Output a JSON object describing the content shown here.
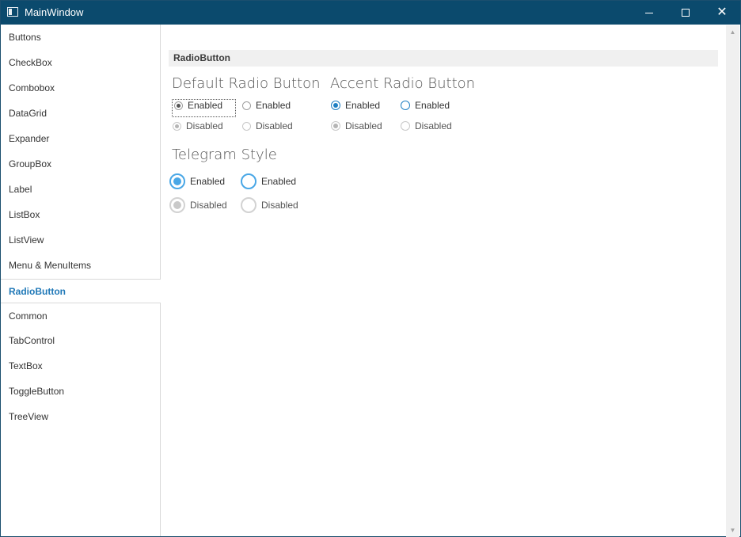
{
  "window": {
    "title": "MainWindow"
  },
  "sidebar": {
    "items": [
      {
        "label": "Buttons"
      },
      {
        "label": "CheckBox"
      },
      {
        "label": "Combobox"
      },
      {
        "label": "DataGrid"
      },
      {
        "label": "Expander"
      },
      {
        "label": "GroupBox"
      },
      {
        "label": "Label"
      },
      {
        "label": "ListBox"
      },
      {
        "label": "ListView"
      },
      {
        "label": "Menu & MenuItems"
      },
      {
        "label": "RadioButton",
        "selected": true
      },
      {
        "label": "Common"
      },
      {
        "label": "TabControl"
      },
      {
        "label": "TextBox"
      },
      {
        "label": "ToggleButton"
      },
      {
        "label": "TreeView"
      }
    ]
  },
  "content": {
    "header": "RadioButton",
    "default_group": {
      "title": "Default Radio Button",
      "enabled_checked": "Enabled",
      "enabled_unchecked": "Enabled",
      "disabled_checked": "Disabled",
      "disabled_unchecked": "Disabled"
    },
    "accent_group": {
      "title": "Accent Radio Button",
      "enabled_checked": "Enabled",
      "enabled_unchecked": "Enabled",
      "disabled_checked": "Disabled",
      "disabled_unchecked": "Disabled"
    },
    "telegram_group": {
      "title": "Telegram Style",
      "enabled_checked": "Enabled",
      "enabled_unchecked": "Enabled",
      "disabled_checked": "Disabled",
      "disabled_unchecked": "Disabled"
    }
  },
  "colors": {
    "titlebar": "#0b4a6d",
    "accent": "#1f7fc2",
    "telegram": "#49a7e6",
    "selected_nav": "#2179b8"
  }
}
